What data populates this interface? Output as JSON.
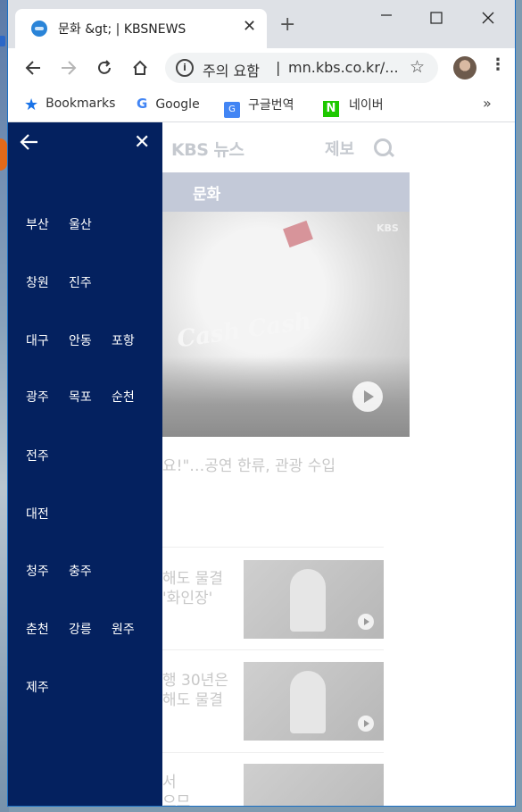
{
  "browser": {
    "tab_title": "문화 &gt; | KBSNEWS",
    "new_tab": "+",
    "omnibox": {
      "warning": "주의 요함",
      "separator": "|",
      "url": "mn.kbs.co.kr/..."
    },
    "bookmarks": [
      {
        "label": "Bookmarks",
        "icon": "star-icon"
      },
      {
        "label": "Google",
        "icon": "google-icon"
      },
      {
        "label": "구글번역",
        "icon": "translate-icon"
      },
      {
        "label": "네이버",
        "icon": "naver-icon"
      }
    ],
    "more": "»"
  },
  "page": {
    "logo": "KBS 뉴스",
    "report_link": "제보",
    "section_title": "문화",
    "hero_overlay": "Cash Cash",
    "hero_mark": "KBS",
    "headline": "요!\"…공연 한류, 관광 수입",
    "news": [
      {
        "line1": "해도 물결",
        "line2": "'화인장'"
      },
      {
        "line1": "행 30년은",
        "line2": "해도 물결"
      },
      {
        "line1": "서",
        "line2": "으므"
      }
    ]
  },
  "drawer": {
    "regions": [
      [
        "부산",
        "울산"
      ],
      [
        "창원",
        "진주"
      ],
      [
        "대구",
        "안동",
        "포항"
      ],
      [
        "광주",
        "목포",
        "순천"
      ],
      [
        "전주"
      ],
      [
        "대전"
      ],
      [
        "청주",
        "충주"
      ],
      [
        "춘천",
        "강릉",
        "원주"
      ],
      [
        "제주"
      ]
    ]
  },
  "colors": {
    "drawer_bg": "#04215f",
    "section_bar": "#c3c9d8",
    "naver_green": "#1ec800"
  }
}
